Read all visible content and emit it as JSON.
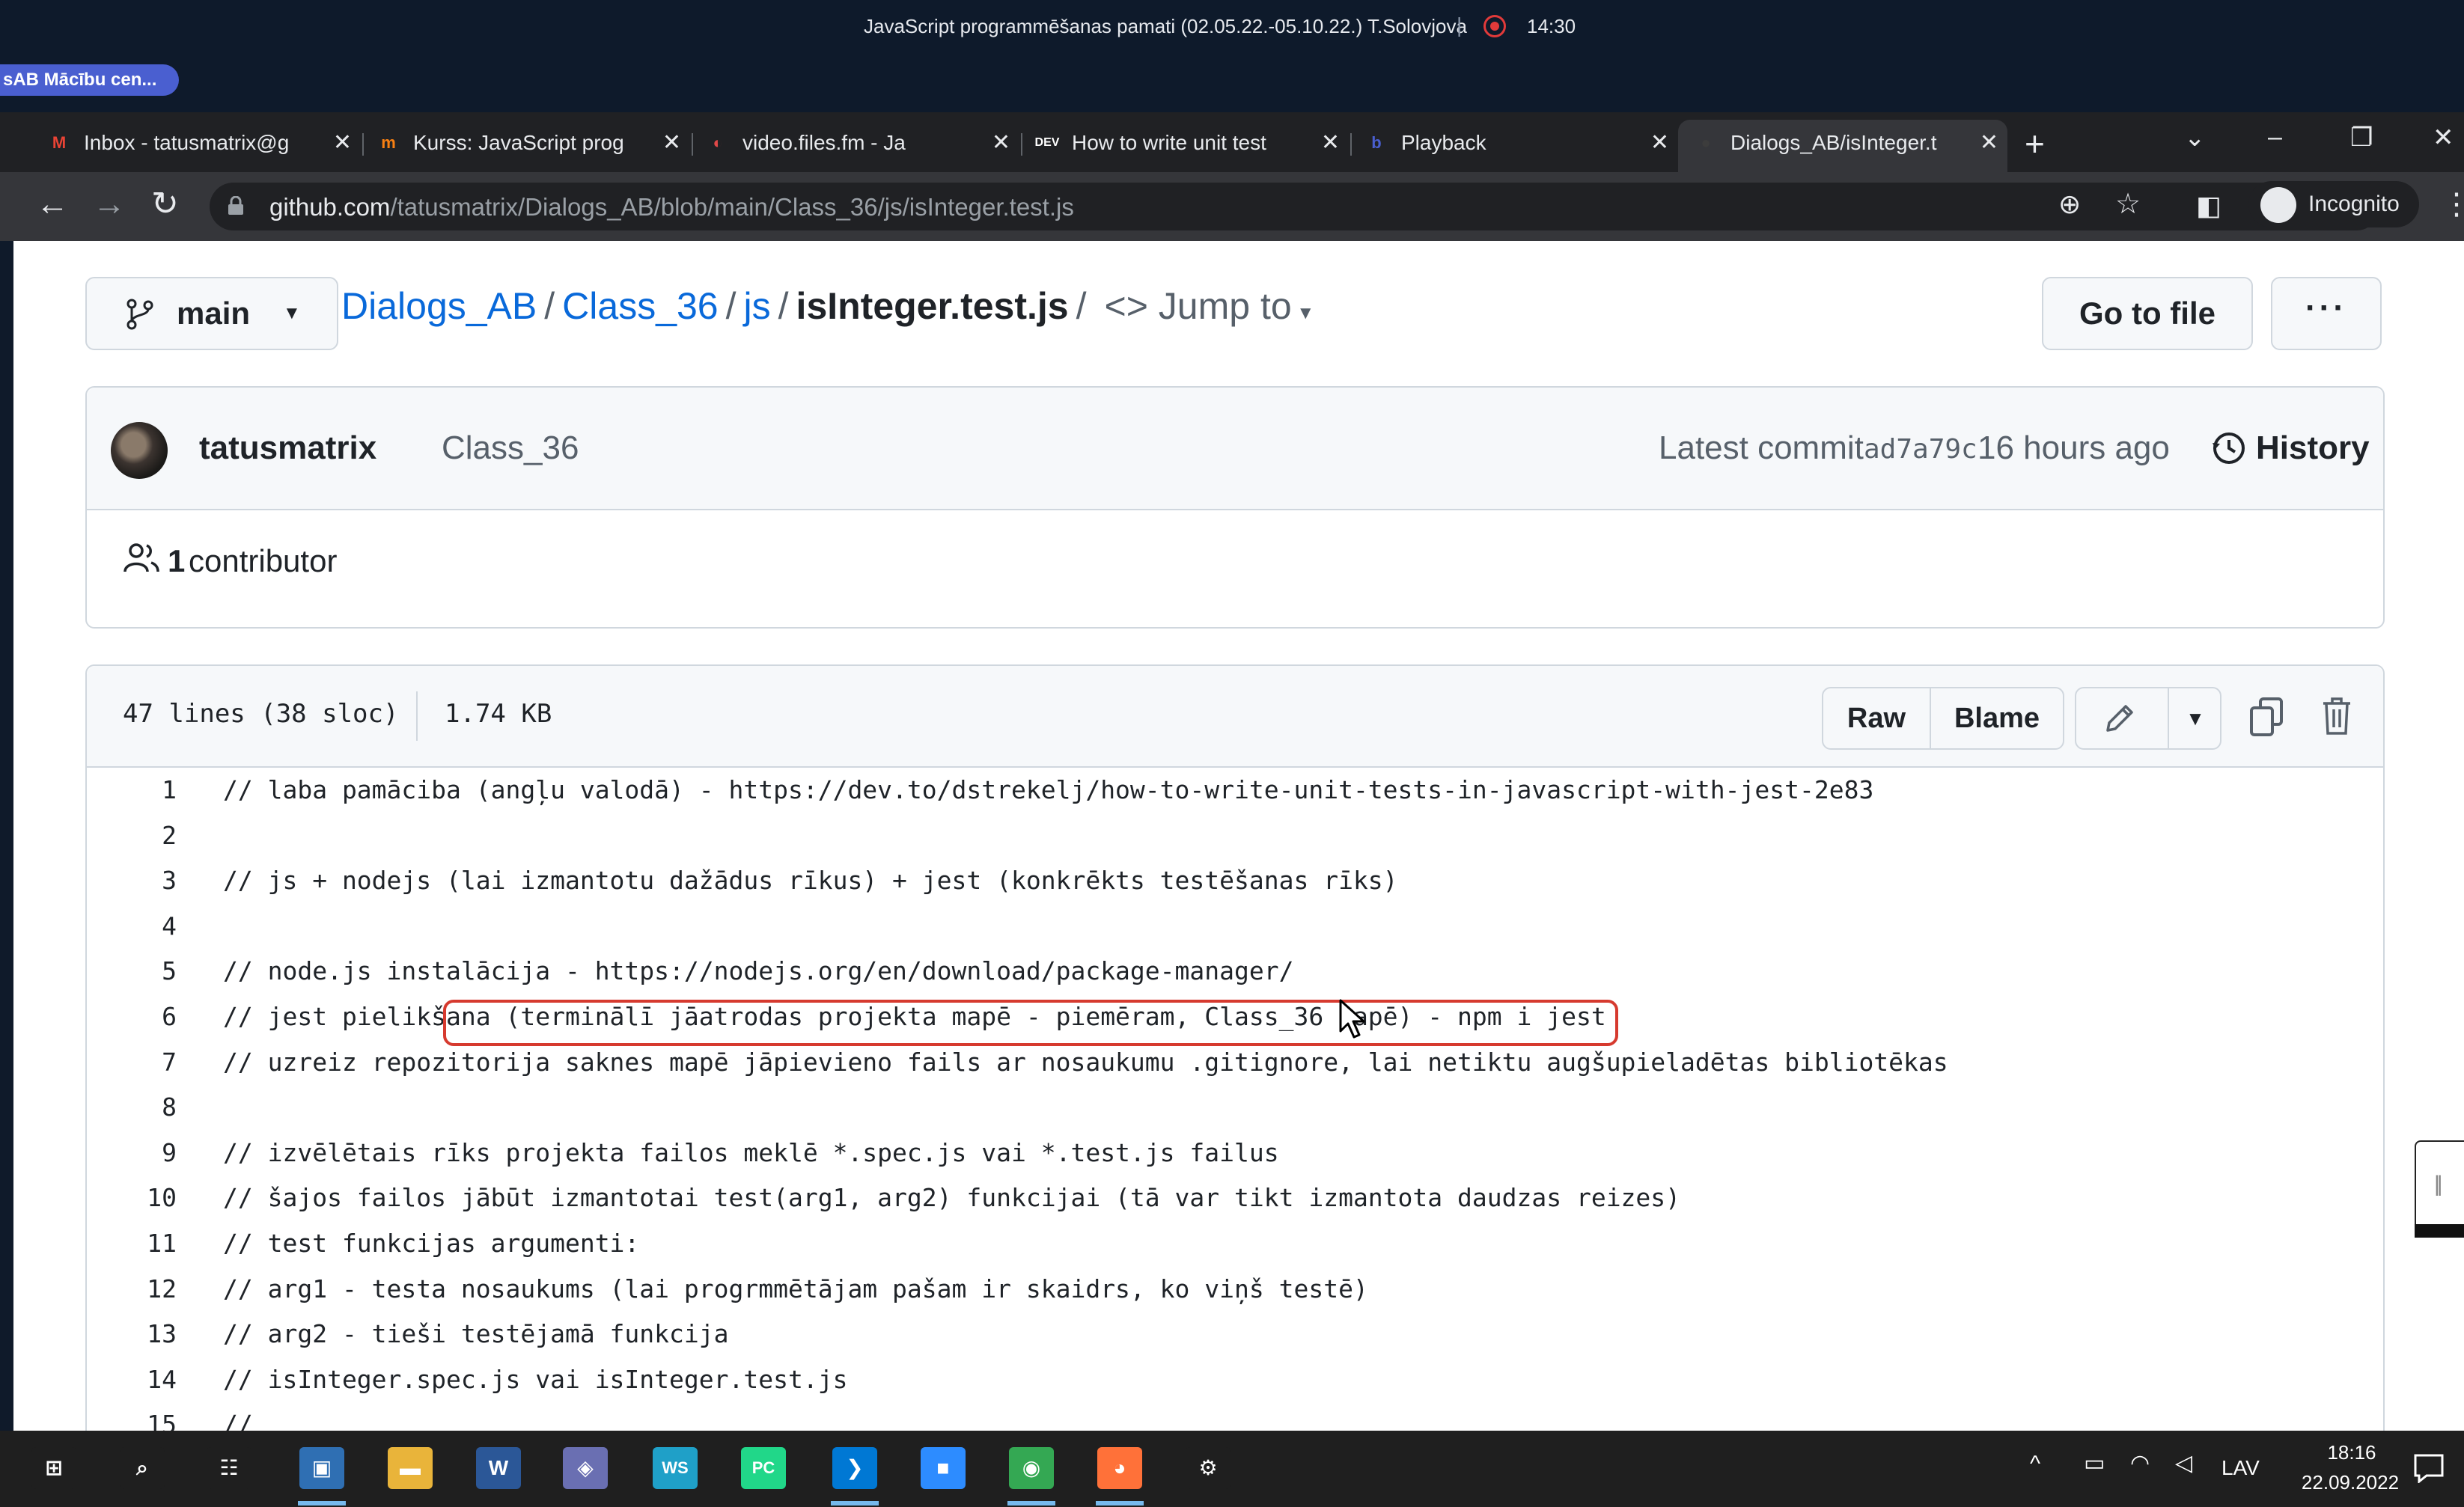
{
  "meeting": {
    "title": "JavaScript programmēšanas pamati (02.05.22.-05.10.22.) T.Solovjova",
    "separator": "|",
    "time": "14:30",
    "presenter_badge": "sAB Mācību cen..."
  },
  "browser": {
    "tabs": [
      {
        "label": "Inbox - tatusmatrix@g",
        "favicon": "gmail-icon",
        "glyph": "M",
        "color": "#ea4335"
      },
      {
        "label": "Kurss: JavaScript prog",
        "favicon": "moodle-icon",
        "glyph": "m",
        "color": "#f98012"
      },
      {
        "label": "video.files.fm - Ja",
        "favicon": "filesfm-icon",
        "glyph": "◐",
        "color": "#e04848"
      },
      {
        "label": "How to write unit test",
        "favicon": "dev-icon",
        "glyph": "DEV",
        "color": "#ffffff"
      },
      {
        "label": "Playback",
        "favicon": "playback-icon",
        "glyph": "b",
        "color": "#4a5fd0"
      },
      {
        "label": "Dialogs_AB/isInteger.t",
        "favicon": "github-icon",
        "glyph": "●",
        "color": "#3c3c3c"
      }
    ],
    "active_tab": 5,
    "url_host": "github.com",
    "url_path": "/tatusmatrix/Dialogs_AB/blob/main/Class_36/js/isInteger.test.js",
    "incognito_label": "Incognito"
  },
  "repo": {
    "branch": "main",
    "breadcrumb": [
      "Dialogs_AB",
      "Class_36",
      "js"
    ],
    "file_name": "isInteger.test.js",
    "jump_to": "Jump to",
    "go_to_file": "Go to file",
    "more": "···"
  },
  "commit": {
    "author": "tatusmatrix",
    "message": "Class_36",
    "latest_label": "Latest commit",
    "sha": "ad7a79c",
    "ago": "16 hours ago",
    "history": "History",
    "contributors_count": "1",
    "contributors_label": "contributor"
  },
  "file": {
    "lines_info": "47 lines (38 sloc)",
    "size": "1.74 KB",
    "raw": "Raw",
    "blame": "Blame",
    "code": [
      {
        "n": "1",
        "text": "// laba pamāciba (angļu valodā) - https://dev.to/dstrekelj/how-to-write-unit-tests-in-javascript-with-jest-2e83"
      },
      {
        "n": "2",
        "text": ""
      },
      {
        "n": "3",
        "text": "// js + nodejs (lai izmantotu dažādus rīkus) + jest (konkrēkts testēšanas rīks)"
      },
      {
        "n": "4",
        "text": ""
      },
      {
        "n": "5",
        "text": "// node.js instalācija - https://nodejs.org/en/download/package-manager/"
      },
      {
        "n": "6",
        "text": "// jest pielikšana (terminālī jāatrodas projekta mapē - piemēram, Class_36 mapē) - npm i jest"
      },
      {
        "n": "7",
        "text": "// uzreiz repozitorija saknes mapē jāpievieno fails ar nosaukumu .gitignore, lai netiktu augšupieladētas bibliotēkas"
      },
      {
        "n": "8",
        "text": ""
      },
      {
        "n": "9",
        "text": "// izvēlētais rīks projekta failos meklē *.spec.js vai *.test.js failus"
      },
      {
        "n": "10",
        "text": "// šajos failos jābūt izmantotai test(arg1, arg2) funkcijai (tā var tikt izmantota daudzas reizes)"
      },
      {
        "n": "11",
        "text": "// test funkcijas argumenti:"
      },
      {
        "n": "12",
        "text": "// arg1 - testa nosaukums (lai progrmmētājam pašam ir skaidrs, ko viņš testē)"
      },
      {
        "n": "13",
        "text": "// arg2 - tieši testējamā funkcija"
      },
      {
        "n": "14",
        "text": "// isInteger.spec.js vai isInteger.test.js"
      },
      {
        "n": "15",
        "text": "//"
      }
    ],
    "highlight_color": "#d63a2f"
  },
  "taskbar": {
    "apps": [
      {
        "name": "start-icon",
        "glyph": "⊞",
        "color": "#1f1f1f"
      },
      {
        "name": "search-icon",
        "glyph": "⌕",
        "color": "#1f1f1f"
      },
      {
        "name": "task-view-icon",
        "glyph": "☷",
        "color": "#1f1f1f"
      },
      {
        "name": "remote-desktop-icon",
        "glyph": "▣",
        "color": "#2f6fb3"
      },
      {
        "name": "file-explorer-icon",
        "glyph": "▬",
        "color": "#e9b43a"
      },
      {
        "name": "word-icon",
        "glyph": "W",
        "color": "#2b5797"
      },
      {
        "name": "app-icon",
        "glyph": "◈",
        "color": "#6a6fb2"
      },
      {
        "name": "webstorm-icon",
        "glyph": "WS",
        "color": "#1fa0c8"
      },
      {
        "name": "pycharm-icon",
        "glyph": "PC",
        "color": "#21d789"
      },
      {
        "name": "vscode-icon",
        "glyph": "❯",
        "color": "#0078d4"
      },
      {
        "name": "zoom-icon",
        "glyph": "■",
        "color": "#2d8cff"
      },
      {
        "name": "chrome-icon",
        "glyph": "◉",
        "color": "#34a853"
      },
      {
        "name": "firefox-icon",
        "glyph": "◕",
        "color": "#ff7139"
      },
      {
        "name": "settings-icon",
        "glyph": "⚙",
        "color": "#1f1f1f"
      }
    ],
    "lang": "LAV",
    "time": "18:16",
    "date": "22.09.2022"
  }
}
